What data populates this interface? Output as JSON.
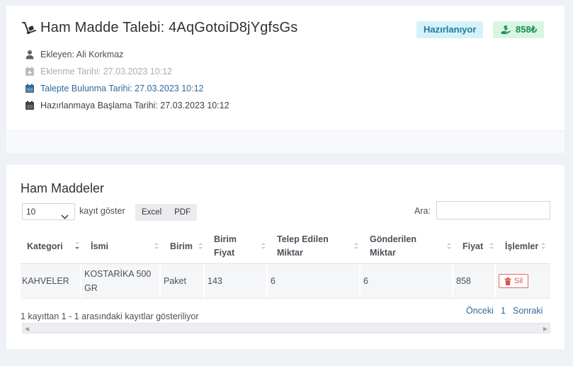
{
  "header": {
    "title": "Ham Madde Talebi: 4AqGotoiD8jYgfsGs",
    "status_badge": "Hazırlanıyor",
    "price_badge": "858₺"
  },
  "info": {
    "added_by": "Ekleyen: Ali Korkmaz",
    "added_date": "Eklenme Tarihi: 27.03.2023 10:12",
    "requested_date": "Talepte Bulunma Tarihi: 27.03.2023 10:12",
    "prep_start_date": "Hazırlanmaya Başlama Tarihi: 27.03.2023 10:12"
  },
  "materials": {
    "section_title": "Ham Maddeler",
    "length_value": "10",
    "length_label": "kayıt göster",
    "export_buttons": [
      "Excel",
      "PDF"
    ],
    "search_label": "Ara:",
    "search_value": "",
    "columns": [
      "Kategori",
      "İsmi",
      "Birim",
      "Birim Fiyat",
      "Telep Edilen Miktar",
      "Gönderilen Miktar",
      "Fiyat",
      "İşlemler"
    ],
    "rows": [
      {
        "kategori": "KAHVELER",
        "ismi": "KOSTARİKA 500 GR",
        "birim": "Paket",
        "birim_fiyat": "143",
        "talep_miktar": "6",
        "gonderilen_miktar": "6",
        "fiyat": "858",
        "delete_label": "Sil"
      }
    ],
    "footer_info": "1 kayıttan 1 - 1 arasındaki kayıtlar gösteriliyor",
    "pager": {
      "prev": "Önceki",
      "page": "1",
      "next": "Sonraki"
    }
  },
  "colors": {
    "status_bg": "#d5f2fb",
    "status_fg": "#217a9a",
    "price_bg": "#d8f5e4",
    "price_fg": "#1f8a4c",
    "link": "#2f6a9b",
    "danger": "#d9534f"
  },
  "icons": {
    "title": "hand-dolly-icon",
    "price": "hand-holding-dollar-icon",
    "user": "user-icon",
    "calendar": "calendar-icon",
    "trash": "trash-icon"
  }
}
